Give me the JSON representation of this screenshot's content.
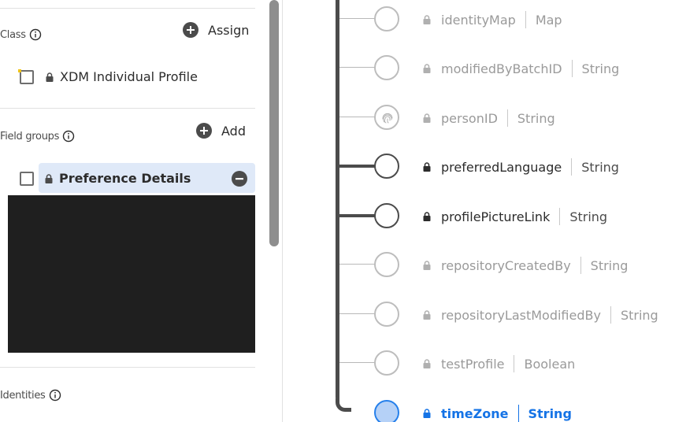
{
  "class_section": {
    "label": "Class",
    "assign_label": "Assign",
    "class_name": "XDM Individual Profile"
  },
  "field_groups_section": {
    "label": "Field groups",
    "add_label": "Add",
    "items": [
      {
        "name": "Preference Details",
        "selected": true
      }
    ]
  },
  "identities_section": {
    "label": "Identities"
  },
  "schema_fields": [
    {
      "name": "identityMap",
      "type": "Map",
      "state": "muted"
    },
    {
      "name": "modifiedByBatchID",
      "type": "String",
      "state": "muted"
    },
    {
      "name": "personID",
      "type": "String",
      "state": "muted",
      "icon": "fingerprint-icon"
    },
    {
      "name": "preferredLanguage",
      "type": "String",
      "state": "active"
    },
    {
      "name": "profilePictureLink",
      "type": "String",
      "state": "active"
    },
    {
      "name": "repositoryCreatedBy",
      "type": "String",
      "state": "muted"
    },
    {
      "name": "repositoryLastModifiedBy",
      "type": "String",
      "state": "muted"
    },
    {
      "name": "testProfile",
      "type": "Boolean",
      "state": "muted"
    },
    {
      "name": "timeZone",
      "type": "String",
      "state": "selected"
    }
  ],
  "colors": {
    "accent": "#1473e6",
    "selected_fill": "#dfe9f8",
    "tree_line": "#4b4b4b"
  }
}
